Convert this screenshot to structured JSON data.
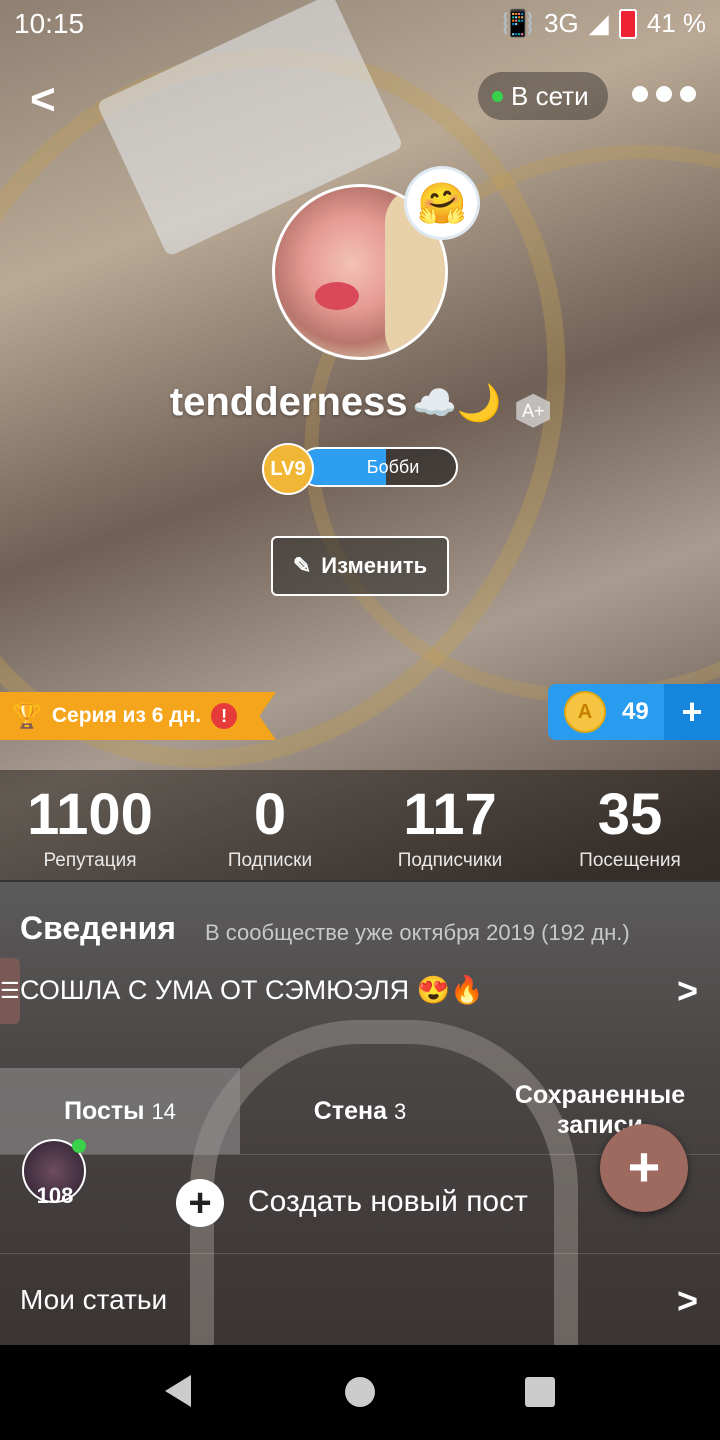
{
  "status_bar": {
    "time": "10:15",
    "network": "3G",
    "battery": "41 %"
  },
  "header": {
    "online_label": "В сети"
  },
  "profile": {
    "username": "tendderness",
    "username_emoji": "☁️🌙",
    "sticker_emoji": "🤗",
    "aplus_label": "A+",
    "level_label": "LV9",
    "level_title": "Бобби",
    "level_progress": 0.55,
    "edit_label": "Изменить"
  },
  "streak": {
    "label": "Серия из 6 дн.",
    "warn": "!"
  },
  "coins": {
    "coin_letter": "A",
    "count": "49",
    "add": "+"
  },
  "stats": [
    {
      "value": "1100",
      "label": "Репутация"
    },
    {
      "value": "0",
      "label": "Подписки"
    },
    {
      "value": "117",
      "label": "Подписчики"
    },
    {
      "value": "35",
      "label": "Посещения"
    }
  ],
  "info": {
    "title": "Сведения",
    "since": "В сообществе уже октября 2019 (192 дн.)",
    "bio": "СОШЛА С УМА ОТ СЭМЮЭЛЯ 😍🔥"
  },
  "tabs": [
    {
      "label": "Посты",
      "count": "14"
    },
    {
      "label": "Стена",
      "count": "3"
    },
    {
      "label": "Сохраненные записи",
      "count": ""
    }
  ],
  "new_post": {
    "avatar_badge": "108",
    "label": "Создать новый пост"
  },
  "my_articles": {
    "label": "Мои статьи"
  },
  "colors": {
    "accent_blue": "#2a9cf0",
    "streak_orange": "#f4a51c",
    "online_green": "#39d14a"
  }
}
